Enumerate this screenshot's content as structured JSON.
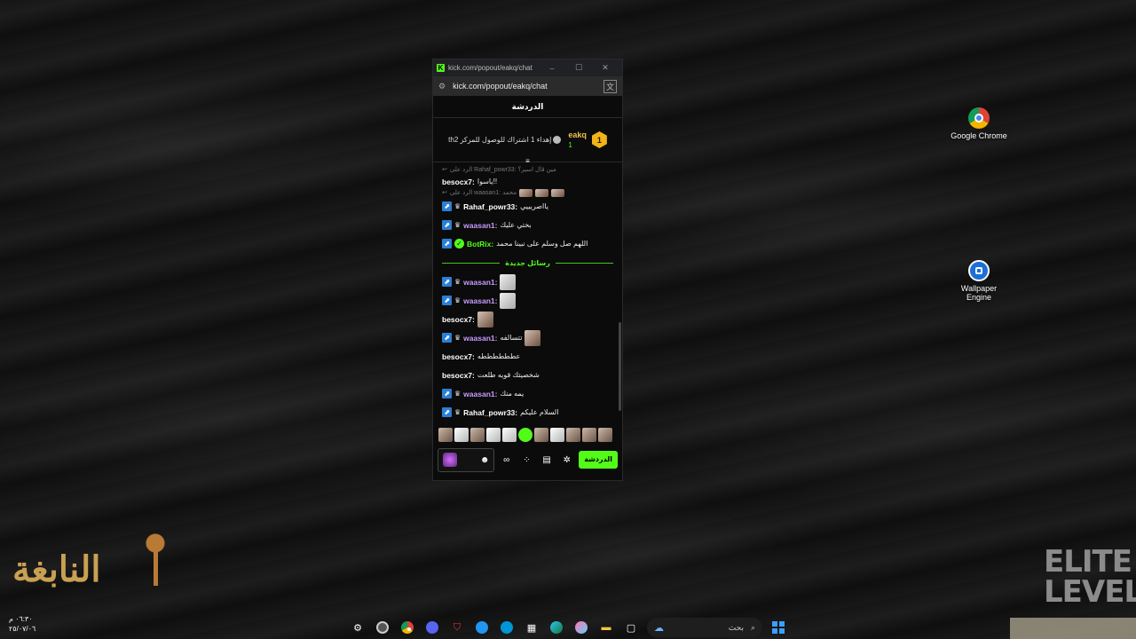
{
  "desktop_icons": [
    {
      "label": "Google Chrome",
      "icon": "chrome-icon"
    },
    {
      "label": "Wallpaper Engine",
      "icon": "wallpaper-engine-icon"
    }
  ],
  "browser": {
    "title": "kick.com/popout/eakq/chat",
    "url": "kick.com/popout/eakq/chat",
    "controls": {
      "minimize": "–",
      "maximize": "☐",
      "close": "✕"
    }
  },
  "chat": {
    "header": "الدردشة",
    "pinned": {
      "rank": "1",
      "username": "eakq",
      "count": "1",
      "goal_text_a": "إهداء 1 اشتراك للوصول للمركز 2",
      "goal_text_b": "th"
    },
    "messages": [
      {
        "type": "reply",
        "text": "الرد على Rahaf_powr33: مين قال اسير؟"
      },
      {
        "type": "msg",
        "user": "besocx7:",
        "color": "c-white",
        "badges": [],
        "text": "ياسوا!!"
      },
      {
        "type": "reply",
        "text": "الرد على waasan1: محمد"
      },
      {
        "type": "msg",
        "user": "Rahaf_powr33:",
        "color": "c-white",
        "badges": [
          "sub",
          "crown"
        ],
        "text": "يااصريييي"
      },
      {
        "type": "msg",
        "user": "waasan1:",
        "color": "c-purple",
        "badges": [
          "sub",
          "crown"
        ],
        "text": "بختي عليك"
      },
      {
        "type": "msg",
        "user": "BotRix:",
        "color": "c-green",
        "badges": [
          "sub",
          "bot"
        ],
        "text": "اللهم صل وسلم على نبينا محمد"
      }
    ],
    "new_messages_label": "رسائل جديدة",
    "new_messages": [
      {
        "user": "waasan1:",
        "color": "c-purple",
        "badges": [
          "sub",
          "crown"
        ],
        "text": "",
        "emote": "light"
      },
      {
        "user": "waasan1:",
        "color": "c-purple",
        "badges": [
          "sub",
          "crown"
        ],
        "text": "",
        "emote": "light"
      },
      {
        "user": "besocx7:",
        "color": "c-white",
        "badges": [],
        "text": "",
        "emote": "dark"
      },
      {
        "user": "waasan1:",
        "color": "c-purple",
        "badges": [
          "sub",
          "crown"
        ],
        "text": "تتسالفه",
        "emote": "dark"
      },
      {
        "user": "besocx7:",
        "color": "c-white",
        "badges": [],
        "text": "عططططططه",
        "emote": ""
      },
      {
        "user": "besocx7:",
        "color": "c-white",
        "badges": [],
        "text": "شخصيتك قويه طلعت",
        "emote": ""
      },
      {
        "user": "waasan1:",
        "color": "c-purple",
        "badges": [
          "sub",
          "crown"
        ],
        "text": "يمه منك",
        "emote": ""
      },
      {
        "user": "Rahaf_powr33:",
        "color": "c-white",
        "badges": [
          "sub",
          "crown"
        ],
        "text": "السلام عليكم",
        "emote": ""
      }
    ],
    "send_label": "الدردشة"
  },
  "watermark_left": "النابغة",
  "watermark_right": "ELITE LEVEL",
  "clock": {
    "time": "٠٦:٣٠ م",
    "date": "٢٥/٠٧/٠٦"
  },
  "taskbar": {
    "search_placeholder": "بحث"
  }
}
